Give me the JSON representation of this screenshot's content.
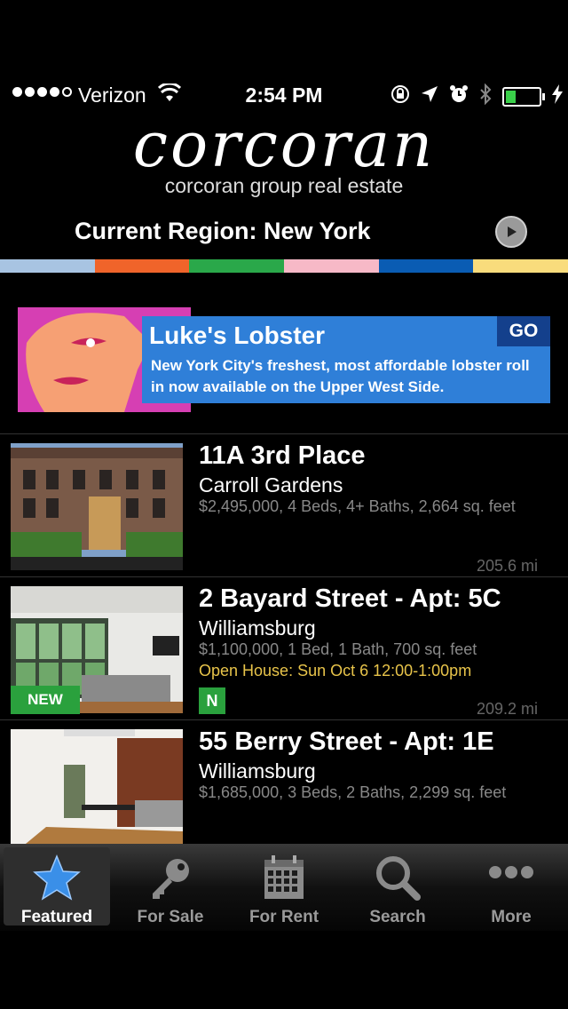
{
  "status_bar": {
    "carrier": "Verizon",
    "time": "2:54 PM",
    "battery_level": 0.3
  },
  "header": {
    "logo": "corcoran",
    "tagline": "corcoran group real estate",
    "region": "Current Region: New York"
  },
  "color_strip": [
    "#a8c4e2",
    "#f0642a",
    "#2aa84a",
    "#f7b9c7",
    "#0a5cb3",
    "#f9dc7c"
  ],
  "ad": {
    "title": "Luke's Lobster",
    "body": "New York City's freshest, most affordable lobster roll in now available on the Upper West Side.",
    "go_label": "GO"
  },
  "listings": [
    {
      "title": "11A 3rd Place",
      "neighborhood": "Carroll Gardens",
      "details": "$2,495,000, 4 Beds, 4+ Baths, 2,664 sq. feet",
      "distance": "205.6 mi"
    },
    {
      "title": "2 Bayard Street - Apt: 5C",
      "neighborhood": "Williamsburg",
      "details": "$1,100,000, 1 Bed, 1 Bath, 700 sq. feet",
      "open_house": "Open House: Sun Oct 6 12:00-1:00pm",
      "new_badge": "NEW",
      "n_badge": "N",
      "distance": "209.2 mi"
    },
    {
      "title": "55 Berry Street - Apt: 1E",
      "neighborhood": "Williamsburg",
      "details": "$1,685,000, 3 Beds, 2 Baths, 2,299 sq. feet"
    }
  ],
  "tabs": [
    {
      "label": "Featured",
      "icon": "star-icon"
    },
    {
      "label": "For Sale",
      "icon": "key-icon"
    },
    {
      "label": "For Rent",
      "icon": "calendar-icon"
    },
    {
      "label": "Search",
      "icon": "search-icon"
    },
    {
      "label": "More",
      "icon": "more-icon"
    }
  ]
}
